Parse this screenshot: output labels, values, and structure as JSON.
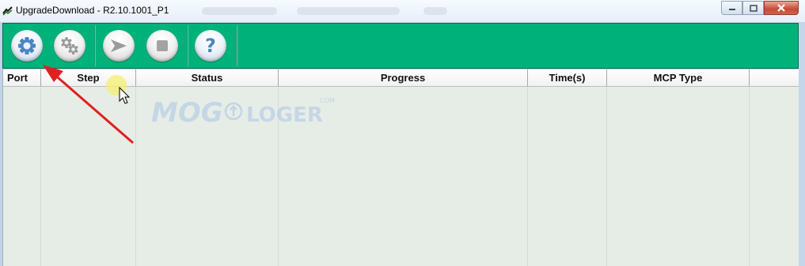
{
  "window": {
    "title": "UpgradeDownload - R2.10.1001_P1"
  },
  "toolbar": {
    "buttons": [
      {
        "name": "settings",
        "icon": "gear-icon"
      },
      {
        "name": "advanced-settings",
        "icon": "gears-icon"
      },
      {
        "name": "start",
        "icon": "play-arrow-icon"
      },
      {
        "name": "stop",
        "icon": "stop-icon"
      },
      {
        "name": "help",
        "icon": "question-icon",
        "glyph": "?"
      }
    ],
    "accent": "#00b27a"
  },
  "table": {
    "columns": [
      "Port",
      "Step",
      "Status",
      "Progress",
      "Time(s)",
      "MCP Type"
    ],
    "rows": []
  },
  "watermark": {
    "left": "MOG",
    "right": "LOGER",
    "suffix": "COM"
  },
  "colors": {
    "toolbar": "#00b27a",
    "table_bg": "#e6ede6",
    "annotation_arrow": "#e02020",
    "close_button": "#c74a34"
  }
}
